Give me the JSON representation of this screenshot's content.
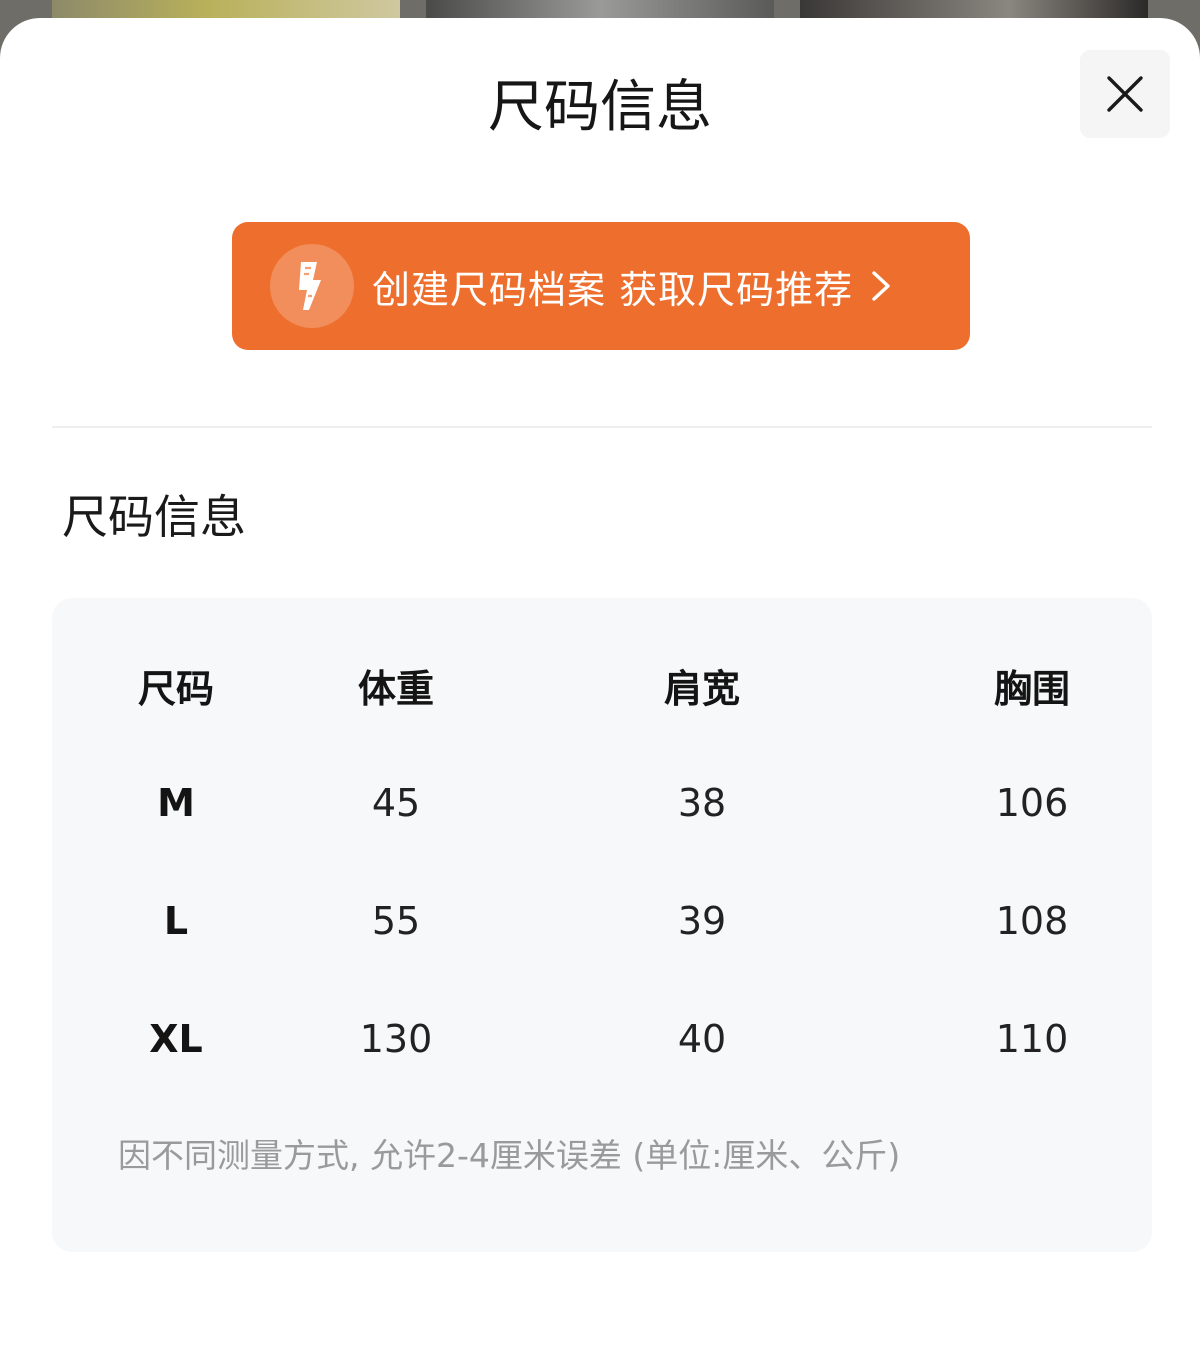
{
  "sheet": {
    "title": "尺码信息",
    "close_icon": "close-icon"
  },
  "cta": {
    "label": "创建尺码档案 获取尺码推荐",
    "icon": "ruler-badge-icon",
    "chevron_icon": "chevron-right-icon",
    "color": "#ee6f2d"
  },
  "section": {
    "title": "尺码信息"
  },
  "table": {
    "headers": [
      "尺码",
      "体重",
      "肩宽",
      "胸围"
    ],
    "rows": [
      {
        "size": "M",
        "weight": "45",
        "shoulder": "38",
        "chest": "106"
      },
      {
        "size": "L",
        "weight": "55",
        "shoulder": "39",
        "chest": "108"
      },
      {
        "size": "XL",
        "weight": "130",
        "shoulder": "40",
        "chest": "110"
      }
    ],
    "note": "因不同测量方式, 允许2-4厘米误差 (单位:厘米、公斤)"
  }
}
